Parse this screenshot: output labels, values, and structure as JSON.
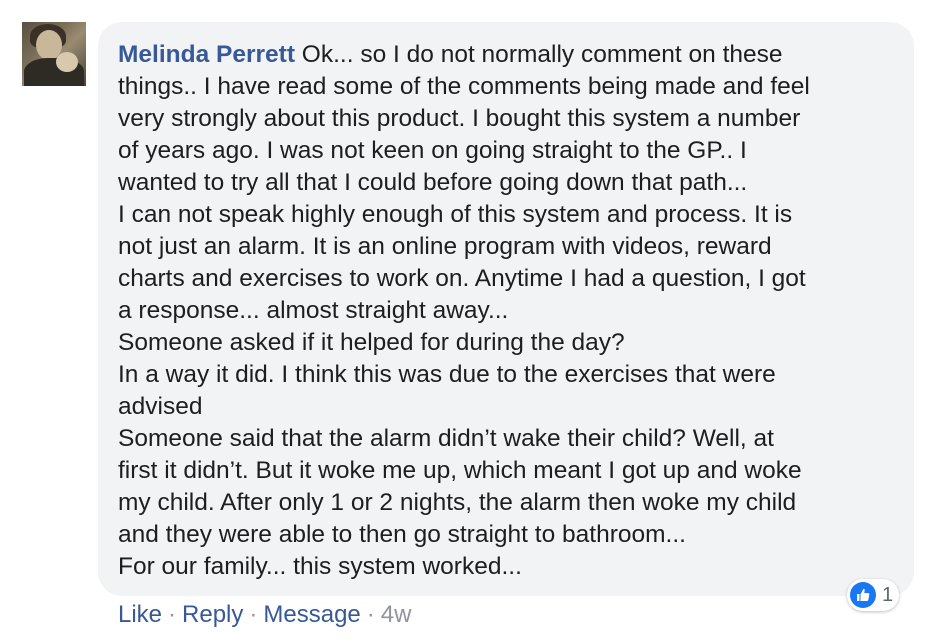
{
  "comment": {
    "author": "Melinda Perrett",
    "lines": [
      " Ok... so I do not normally comment on these",
      "things.. I have read some of the comments being made and feel",
      "very strongly about this product. I bought this system a number",
      "of years ago. I was not keen on going straight to the GP.. I",
      "wanted to try all that I could before going down that path...",
      "I can not speak highly enough of this system and process. It is",
      "not just an alarm. It is an online program with videos, reward",
      "charts and exercises to work on. Anytime I had a question, I got",
      "a response... almost straight away...",
      "Someone asked if it helped for during the day?",
      "In a way it did. I think this was due to the exercises that were",
      "advised",
      "Someone said that the alarm didn’t wake their child? Well, at",
      "first it didn’t. But it woke me up, which meant I got up and woke",
      "my child. After only 1 or 2 nights, the alarm then woke my child",
      "and they were able to then go straight to bathroom...",
      "For our family... this system worked..."
    ],
    "reactions": {
      "icon": "thumbs-up-icon",
      "count": "1",
      "color": "#1877f2"
    },
    "actions": {
      "like": "Like",
      "reply": "Reply",
      "message": "Message",
      "separator": "·",
      "timestamp": "4w"
    }
  },
  "colors": {
    "author": "#385898",
    "bubble": "#f2f3f5",
    "text": "#1c1e21",
    "meta": "#90949c"
  }
}
